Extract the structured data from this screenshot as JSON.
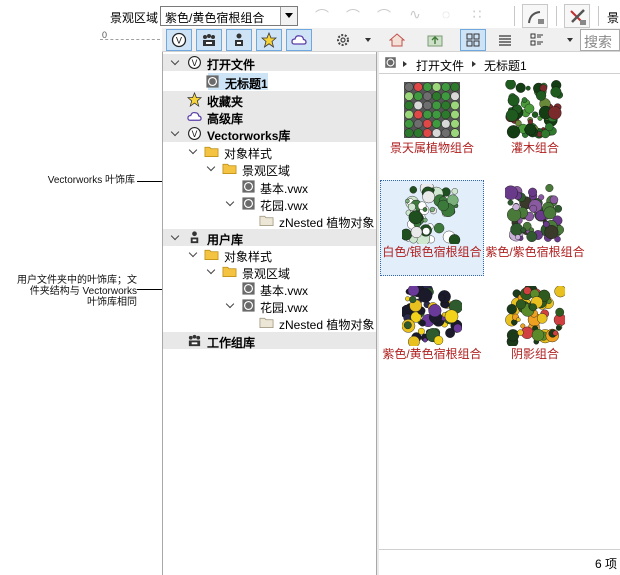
{
  "toolbar": {
    "scope_label": "景观区域",
    "scope_value": "紫色/黄色宿根组合",
    "cut_label": "景",
    "search_placeholder": "搜索"
  },
  "ruler": {
    "zero": "0"
  },
  "toolbar2": {
    "icons": [
      "vectorworks-library-icon",
      "workgroup-library-icon",
      "user-library-icon",
      "favorites-icon",
      "cloud-icon",
      "settings-icon",
      "home-icon",
      "up-folder-icon",
      "grid-view-icon",
      "list-view-icon",
      "detail-view-icon"
    ]
  },
  "annotations": {
    "vw_library": "Vectorworks 叶饰库",
    "user_library_line1": "用户文件夹中的叶饰库；文",
    "user_library_line2": "件夹结构与 Vectorworks",
    "user_library_line3": "叶饰库相同"
  },
  "tree": {
    "open_files": "打开文件",
    "untitled": "无标题1",
    "favorites": "收藏夹",
    "advanced": "高级库",
    "vw_lib": "Vectorworks库",
    "vw_object_styles": "对象样式",
    "vw_landscape": "景观区域",
    "vw_basic": "基本.vwx",
    "vw_garden": "花园.vwx",
    "vw_nested": "zNested 植物对象",
    "user_lib": "用户库",
    "user_object_styles": "对象样式",
    "user_landscape": "景观区域",
    "user_basic": "基本.vwx",
    "user_garden": "花园.vwx",
    "user_nested": "zNested 植物对象",
    "workgroup": "工作组库"
  },
  "content": {
    "breadcrumb": [
      "打开文件",
      "无标题1"
    ],
    "items": [
      {
        "label": "景天属植物组合",
        "palette": "sedum"
      },
      {
        "label": "灌木组合",
        "palette": "shrub"
      },
      {
        "label": "白色/银色宿根组合",
        "palette": "white",
        "selected": true
      },
      {
        "label": "紫色/紫色宿根组合",
        "palette": "purple"
      },
      {
        "label": "紫色/黄色宿根组合",
        "palette": "yellow"
      },
      {
        "label": "阴影组合",
        "palette": "shade"
      }
    ],
    "count": "6 项"
  },
  "colors": {
    "caption": "#b02020",
    "selection": "#cde4f7",
    "folder": "#f5c342"
  }
}
